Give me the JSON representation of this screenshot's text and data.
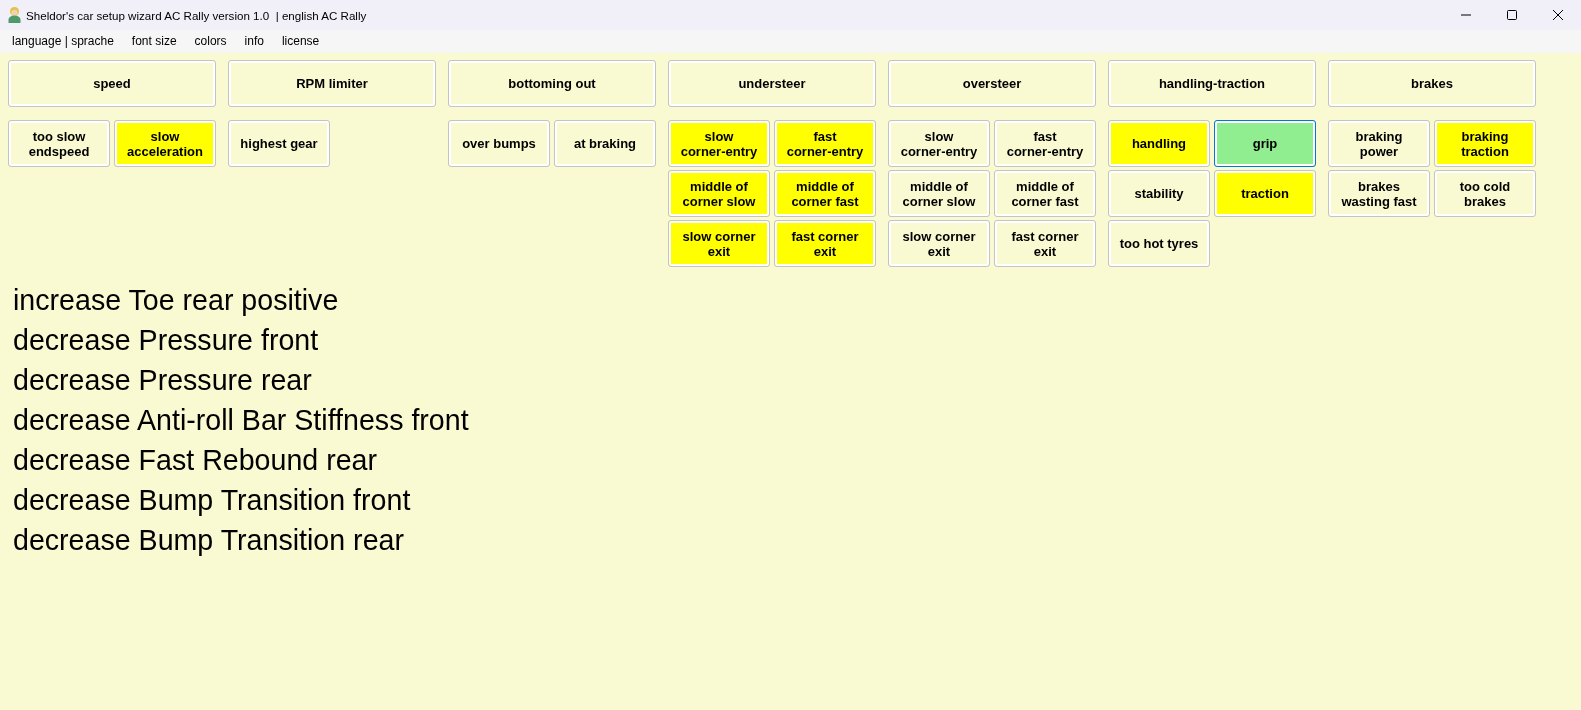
{
  "window": {
    "title": "Sheldor's car setup wizard AC Rally version 1.0  | english AC Rally"
  },
  "menu": [
    "language | sprache",
    "font size",
    "colors",
    "info",
    "license"
  ],
  "categories": [
    {
      "label": "speed",
      "options": [
        {
          "label": "too slow\nendspeed",
          "selected": false,
          "focused": false
        },
        {
          "label": "slow\nacceleration",
          "selected": true,
          "color": "#ffff00",
          "focused": false
        }
      ]
    },
    {
      "label": "RPM limiter",
      "options": [
        {
          "label": "highest gear",
          "selected": false,
          "focused": false
        }
      ]
    },
    {
      "label": "bottoming out",
      "options": [
        {
          "label": "over bumps",
          "selected": false,
          "focused": false
        },
        {
          "label": "at braking",
          "selected": false,
          "focused": false
        }
      ]
    },
    {
      "label": "understeer",
      "options": [
        {
          "label": "slow\ncorner-entry",
          "selected": true,
          "color": "#ffff00",
          "focused": false
        },
        {
          "label": "fast\ncorner-entry",
          "selected": true,
          "color": "#ffff00",
          "focused": false
        },
        {
          "label": "middle of\ncorner slow",
          "selected": true,
          "color": "#ffff00",
          "focused": false
        },
        {
          "label": "middle of\ncorner fast",
          "selected": true,
          "color": "#ffff00",
          "focused": false
        },
        {
          "label": "slow corner\nexit",
          "selected": true,
          "color": "#ffff00",
          "focused": false
        },
        {
          "label": "fast corner\nexit",
          "selected": true,
          "color": "#ffff00",
          "focused": false
        }
      ]
    },
    {
      "label": "oversteer",
      "options": [
        {
          "label": "slow\ncorner-entry",
          "selected": false,
          "focused": false
        },
        {
          "label": "fast\ncorner-entry",
          "selected": false,
          "focused": false
        },
        {
          "label": "middle of\ncorner slow",
          "selected": false,
          "focused": false
        },
        {
          "label": "middle of\ncorner fast",
          "selected": false,
          "focused": false
        },
        {
          "label": "slow corner\nexit",
          "selected": false,
          "focused": false
        },
        {
          "label": "fast corner\nexit",
          "selected": false,
          "focused": false
        }
      ]
    },
    {
      "label": "handling-traction",
      "options": [
        {
          "label": "handling",
          "selected": true,
          "color": "#ffff00",
          "focused": false
        },
        {
          "label": "grip",
          "selected": true,
          "color": "#90ee90",
          "focused": true
        },
        {
          "label": "stability",
          "selected": false,
          "focused": false
        },
        {
          "label": "traction",
          "selected": true,
          "color": "#ffff00",
          "focused": false
        },
        {
          "label": "too hot tyres",
          "selected": false,
          "focused": false
        }
      ]
    },
    {
      "label": "brakes",
      "options": [
        {
          "label": "braking\npower",
          "selected": false,
          "focused": false
        },
        {
          "label": "braking\ntraction",
          "selected": true,
          "color": "#ffff00",
          "focused": false
        },
        {
          "label": "brakes\nwasting fast",
          "selected": false,
          "focused": false
        },
        {
          "label": "too cold\nbrakes",
          "selected": false,
          "focused": false
        }
      ]
    }
  ],
  "recommendations": [
    "increase Toe rear positive",
    "decrease Pressure front",
    "decrease Pressure rear",
    "decrease Anti-roll Bar Stiffness front",
    "decrease Fast Rebound rear",
    "decrease Bump Transition front",
    "decrease Bump Transition rear"
  ]
}
